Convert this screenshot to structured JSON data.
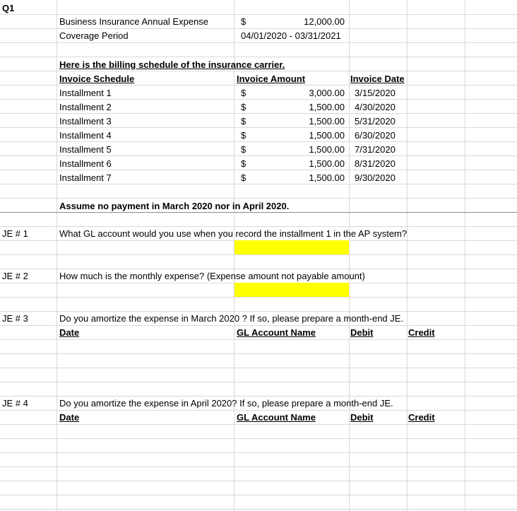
{
  "q_label": "Q1",
  "header": {
    "expense_label": "Business Insurance Annual Expense",
    "currency": "$",
    "expense_value": "12,000.00",
    "period_label": "Coverage Period",
    "period_value": "04/01/2020 - 03/31/2021"
  },
  "schedule": {
    "intro": "Here is the billing schedule of the insurance carrier.",
    "col_schedule": "Invoice Schedule",
    "col_amount": "Invoice Amount",
    "col_date": "Invoice Date",
    "rows": [
      {
        "name": "Installment 1",
        "cur": "$",
        "amount": "3,000.00",
        "date": "3/15/2020"
      },
      {
        "name": "Installment 2",
        "cur": "$",
        "amount": "1,500.00",
        "date": "4/30/2020"
      },
      {
        "name": "Installment 3",
        "cur": "$",
        "amount": "1,500.00",
        "date": "5/31/2020"
      },
      {
        "name": "Installment 4",
        "cur": "$",
        "amount": "1,500.00",
        "date": "6/30/2020"
      },
      {
        "name": "Installment 5",
        "cur": "$",
        "amount": "1,500.00",
        "date": "7/31/2020"
      },
      {
        "name": "Installment 6",
        "cur": "$",
        "amount": "1,500.00",
        "date": "8/31/2020"
      },
      {
        "name": "Installment 7",
        "cur": "$",
        "amount": "1,500.00",
        "date": "9/30/2020"
      }
    ],
    "assumption": "Assume no payment in March 2020 nor in April 2020."
  },
  "questions": [
    {
      "label": "JE # 1",
      "text": "What GL account would you use when you record the installment 1 in the AP system?"
    },
    {
      "label": "JE # 2",
      "text": "How much is the monthly expense? (Expense amount not payable amount)"
    },
    {
      "label": "JE # 3",
      "text": "Do you amortize the expense in March 2020 ? If so, please prepare a month-end JE.",
      "cols": {
        "date": "Date",
        "gl": "GL Account Name",
        "debit": "Debit",
        "credit": "Credit"
      }
    },
    {
      "label": "JE # 4",
      "text": "Do you amortize the expense in April 2020? If so, please prepare a month-end JE.",
      "cols": {
        "date": "Date",
        "gl": "GL Account Name",
        "debit": "Debit",
        "credit": "Credit"
      }
    }
  ]
}
